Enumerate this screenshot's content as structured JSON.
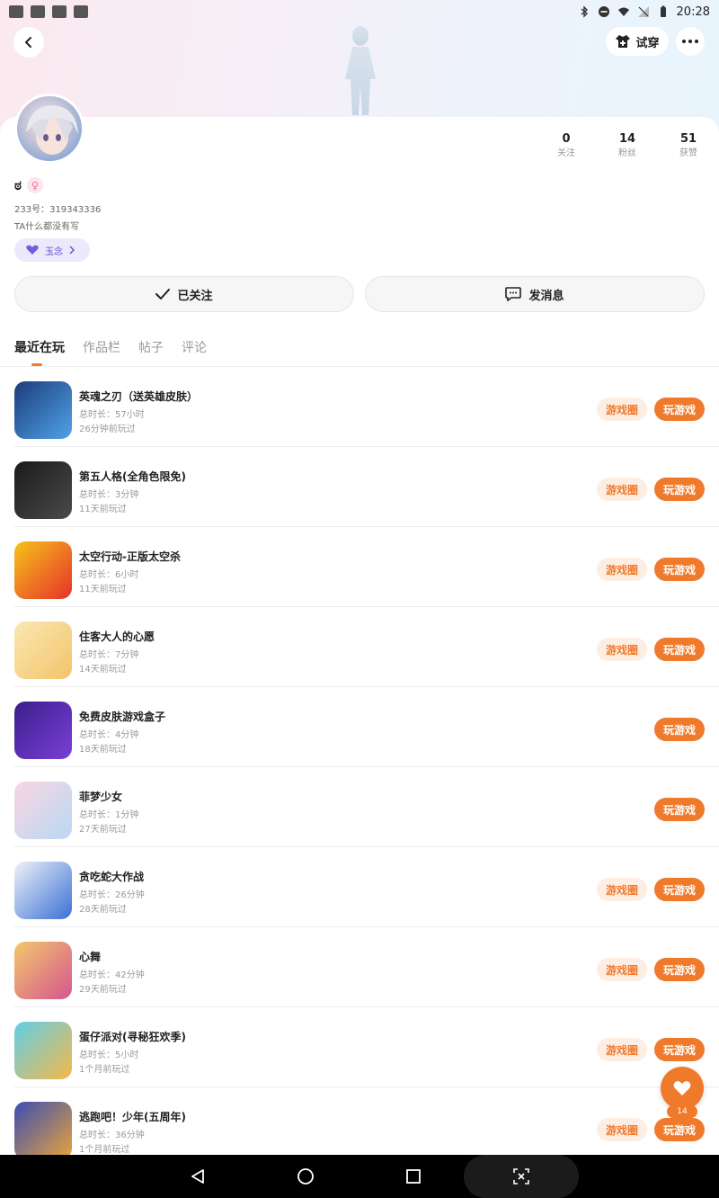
{
  "status_bar": {
    "time": "20:28"
  },
  "header": {
    "tryon_label": "试穿"
  },
  "profile": {
    "name": "ಠ",
    "gender_symbol": "♀",
    "uid_text": "233号：319343336",
    "bio": "TA什么都没有写",
    "badge_label": "玉念",
    "stats": [
      {
        "value": "0",
        "label": "关注"
      },
      {
        "value": "14",
        "label": "粉丝"
      },
      {
        "value": "51",
        "label": "获赞"
      }
    ]
  },
  "actions": {
    "follow_label": "已关注",
    "message_label": "发消息"
  },
  "tabs": [
    "最近在玩",
    "作品栏",
    "帖子",
    "评论"
  ],
  "buttons": {
    "circle_label": "游戏圈",
    "play_label": "玩游戏"
  },
  "games": [
    {
      "title": "英魂之刃（送英雄皮肤）",
      "duration": "总时长：57小时",
      "last": "26分钟前玩过",
      "has_circle": true,
      "colors": [
        "#1d3c7a",
        "#4fa3e8"
      ]
    },
    {
      "title": "第五人格(全角色限免)",
      "duration": "总时长：3分钟",
      "last": "11天前玩过",
      "has_circle": true,
      "colors": [
        "#1a1a1a",
        "#4b4b4b"
      ]
    },
    {
      "title": "太空行动-正版太空杀",
      "duration": "总时长：6小时",
      "last": "11天前玩过",
      "has_circle": true,
      "colors": [
        "#f6c31b",
        "#e6312a"
      ]
    },
    {
      "title": "住客大人的心愿",
      "duration": "总时长：7分钟",
      "last": "14天前玩过",
      "has_circle": true,
      "colors": [
        "#f9e8b3",
        "#f4c36a"
      ]
    },
    {
      "title": "免费皮肤游戏盒子",
      "duration": "总时长：4分钟",
      "last": "18天前玩过",
      "has_circle": false,
      "colors": [
        "#3a1f8c",
        "#7a3fd6"
      ]
    },
    {
      "title": "菲梦少女",
      "duration": "总时长：1分钟",
      "last": "27天前玩过",
      "has_circle": false,
      "colors": [
        "#f9d6e2",
        "#b9d8f3"
      ]
    },
    {
      "title": "贪吃蛇大作战",
      "duration": "总时长：26分钟",
      "last": "28天前玩过",
      "has_circle": true,
      "colors": [
        "#eef2f8",
        "#3b6fd6"
      ]
    },
    {
      "title": "心舞",
      "duration": "总时长：42分钟",
      "last": "29天前玩过",
      "has_circle": true,
      "colors": [
        "#f4c76b",
        "#d4568f"
      ]
    },
    {
      "title": "蛋仔派对(寻秘狂欢季)",
      "duration": "总时长：5小时",
      "last": "1个月前玩过",
      "has_circle": true,
      "colors": [
        "#5fd0e6",
        "#f6b84a"
      ]
    },
    {
      "title": "逃跑吧！少年(五周年)",
      "duration": "总时长：36分钟",
      "last": "1个月前玩过",
      "has_circle": true,
      "colors": [
        "#3b4db2",
        "#e8a43c"
      ]
    }
  ],
  "like": {
    "count": "14"
  },
  "colors": {
    "accent": "#f07a2c",
    "accent_light": "#fdeee3",
    "badge_purple": "#5b4fd0"
  }
}
